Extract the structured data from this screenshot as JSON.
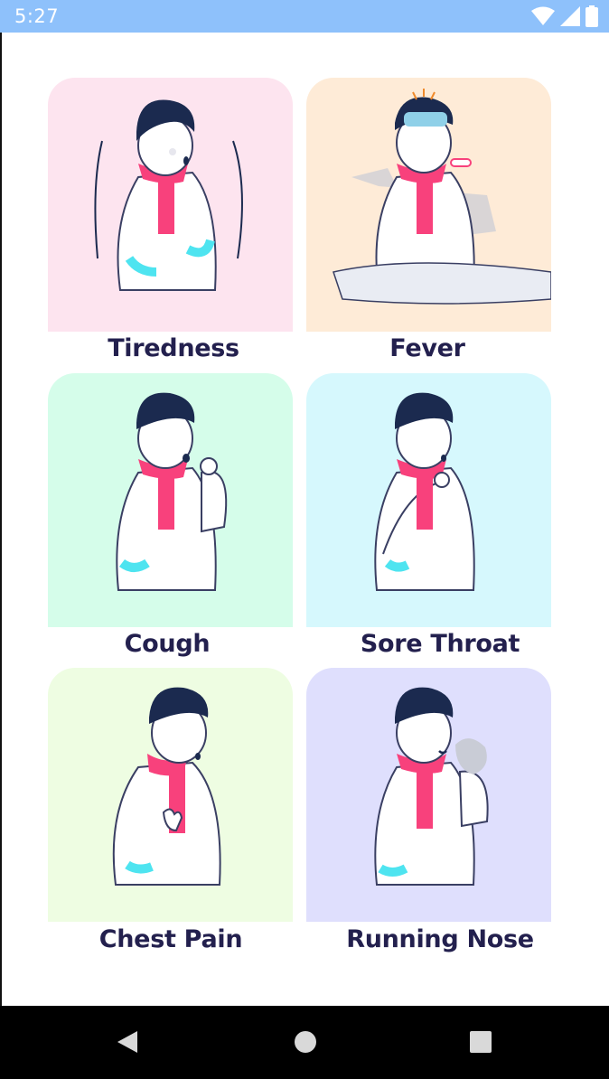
{
  "status": {
    "time": "5:27"
  },
  "symptoms": [
    {
      "label": "Tiredness",
      "bg": "#fde4ef",
      "icon": "tiredness-illustration"
    },
    {
      "label": "Fever",
      "bg": "#feebd7",
      "icon": "fever-illustration"
    },
    {
      "label": "Cough",
      "bg": "#d5fdea",
      "icon": "cough-illustration"
    },
    {
      "label": "Sore Throat",
      "bg": "#d6f8fd",
      "icon": "sore-throat-illustration"
    },
    {
      "label": "Chest Pain",
      "bg": "#eefde2",
      "icon": "chest-pain-illustration"
    },
    {
      "label": "Running Nose",
      "bg": "#dfdffd",
      "icon": "running-nose-illustration"
    }
  ],
  "colors": {
    "label": "#23204e",
    "scarf": "#f8417c",
    "hair": "#1b2a4f",
    "accent": "#4ee4f0"
  },
  "nav": {
    "back": "back-icon",
    "home": "home-icon",
    "recents": "recents-icon"
  }
}
